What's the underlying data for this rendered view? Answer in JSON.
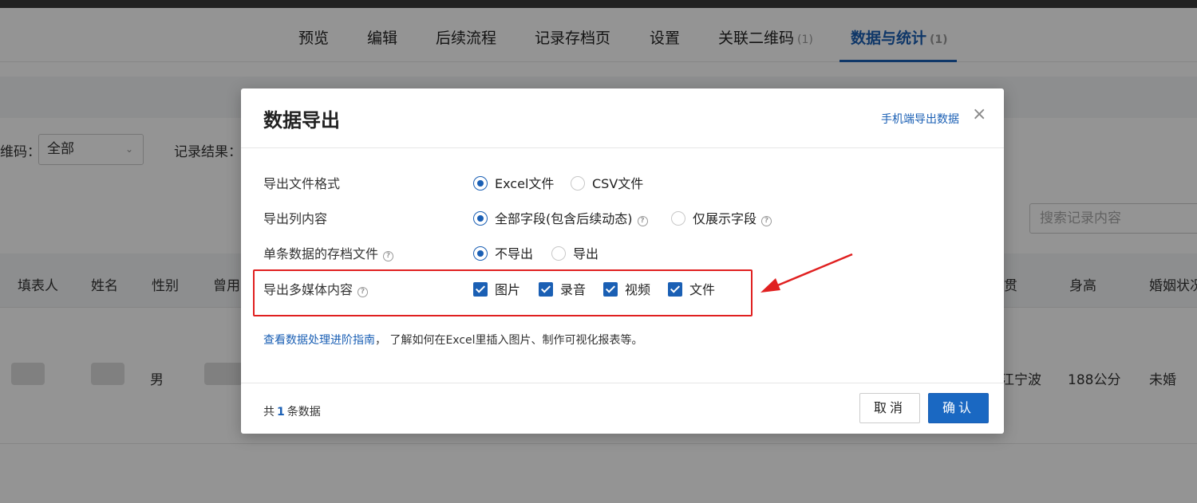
{
  "nav": {
    "items": [
      {
        "label": "预览"
      },
      {
        "label": "编辑"
      },
      {
        "label": "后续流程"
      },
      {
        "label": "记录存档页"
      },
      {
        "label": "设置"
      },
      {
        "label": "关联二维码",
        "count": "(1)"
      },
      {
        "label": "数据与统计",
        "count": "(1)"
      }
    ]
  },
  "filters": {
    "code_label": "维码：",
    "code_value": "全部",
    "result_label": "记录结果："
  },
  "search": {
    "placeholder": "搜索记录内容"
  },
  "table": {
    "headers": [
      "填表人",
      "姓名",
      "性别",
      "曾用",
      "贯",
      "身高",
      "婚姻状况"
    ],
    "row": {
      "gender": "男",
      "place": "江宁波",
      "height": "188公分",
      "marital": "未婚"
    }
  },
  "modal": {
    "title": "数据导出",
    "mobile_link": "手机端导出数据",
    "close": "×",
    "rows": {
      "format_label": "导出文件格式",
      "format_options": [
        "Excel文件",
        "CSV文件"
      ],
      "columns_label": "导出列内容",
      "columns_options": [
        "全部字段(包含后续动态)",
        "仅展示字段"
      ],
      "archive_label": "单条数据的存档文件",
      "archive_options": [
        "不导出",
        "导出"
      ],
      "media_label": "导出多媒体内容",
      "media_options": [
        "图片",
        "录音",
        "视频",
        "文件"
      ]
    },
    "hint_link": "查看数据处理进阶指南",
    "hint_text": "，  了解如何在Excel里插入图片、制作可视化报表等。",
    "total_prefix": "共",
    "total_count": "1",
    "total_suffix": "条数据",
    "cancel": "取消",
    "confirm": "确认"
  },
  "colors": {
    "accent": "#1a5fb4",
    "annotation": "#e02020"
  }
}
